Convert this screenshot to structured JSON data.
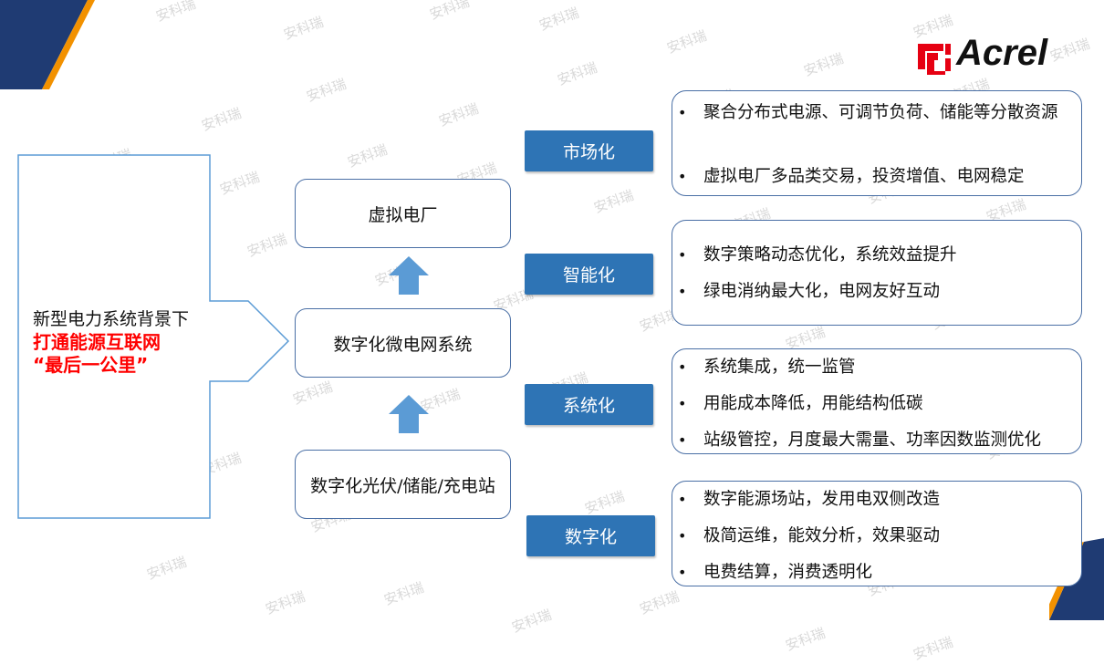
{
  "watermark": "安科瑞",
  "brand": {
    "logo_text": "Acrel",
    "colors": {
      "navy": "#1f3b73",
      "orange": "#f29100",
      "logo_red": "#e60012",
      "tag_blue": "#2e74b5",
      "arrow_blue": "#5b9bd5",
      "border": "#4a6fa5",
      "highlight_red": "#ff0000"
    }
  },
  "left": {
    "line1": "新型电力系统背景下",
    "line2": "打通能源互联网",
    "line3": "“最后一公里”"
  },
  "middle": {
    "top": "虚拟电厂",
    "mid": "数字化微电网系统",
    "bottom": "数字化光伏/储能/充电站"
  },
  "tags": [
    "市场化",
    "智能化",
    "系统化",
    "数字化"
  ],
  "panels": [
    {
      "bullets": [
        "聚合分布式电源、可调节负荷、储能等分散资源",
        "虚拟电厂多品类交易，投资增值、电网稳定"
      ]
    },
    {
      "bullets": [
        "数字策略动态优化，系统效益提升",
        "绿电消纳最大化，电网友好互动"
      ]
    },
    {
      "bullets": [
        "系统集成，统一监管",
        "用能成本降低，用能结构低碳",
        "站级管控，月度最大需量、功率因数监测优化"
      ]
    },
    {
      "bullets": [
        "数字能源场站，发用电双侧改造",
        "极简运维，能效分析，效果驱动",
        "电费结算，消费透明化"
      ]
    }
  ],
  "bullet_symbol": "•"
}
